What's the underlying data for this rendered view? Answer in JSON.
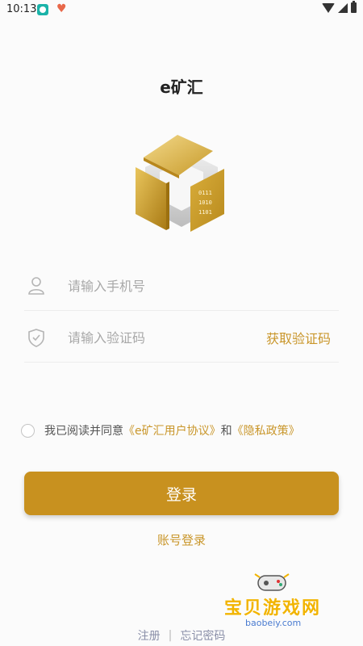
{
  "status_bar": {
    "time": "10:13"
  },
  "app_title": "e矿汇",
  "phone_field": {
    "placeholder": "请输入手机号"
  },
  "code_field": {
    "placeholder": "请输入验证码",
    "get_code": "获取验证码"
  },
  "agreement": {
    "prefix": "我已阅读并同意",
    "user_agreement": "《e矿汇用户协议》",
    "and": "和",
    "privacy_policy": "《隐私政策》"
  },
  "login_button": "登录",
  "account_login": "账号登录",
  "bottom": {
    "register": "注册",
    "separator": "|",
    "forgot_password": "忘记密码"
  },
  "watermark": {
    "name": "宝贝游戏网",
    "url": "baobeiy.com"
  },
  "logo": {
    "chip_lines": [
      "0111",
      "1010",
      "1101"
    ]
  },
  "colors": {
    "accent": "#c8911f",
    "link": "#c9962a",
    "bottom_link": "#8a8fa8"
  },
  "icons": [
    "user-icon",
    "shield-check-icon",
    "cube-logo",
    "wifi-icon",
    "signal-icon",
    "battery-icon"
  ]
}
